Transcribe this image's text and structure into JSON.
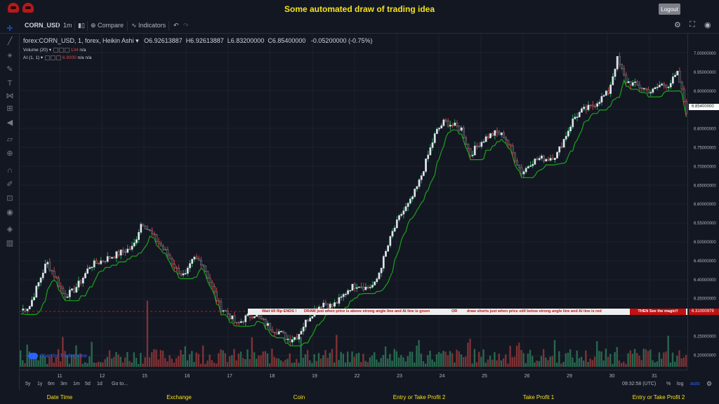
{
  "header": {
    "title": "Some automated draw of trading idea",
    "logout_label": "Logout"
  },
  "toolbar": {
    "symbol": "CORN_USD",
    "interval": "1m",
    "compare_label": "Compare",
    "indicators_label": "Indicators"
  },
  "legend": {
    "symbol_line": "forex:CORN_USD, 1, forex, Heikin Ashi",
    "open": "O6.92613887",
    "high": "H6.92613887",
    "low": "L6.83200000",
    "close": "C6.85400000",
    "change": "-0.05200000 (-0.75%)",
    "volume_label": "Volume (20)",
    "volume_value": "134",
    "volume_extra": "n/a",
    "ai_label": "AI (1, 1)",
    "ai_value": "6.9000",
    "ai_extra1": "n/a",
    "ai_extra2": "n/a"
  },
  "banner": {
    "part1": "Wait till flip ENDS  !",
    "part2": "DRAW just when  price is above strong angle line and AI line is green",
    "part3": "OR",
    "part4": "draw shorts just when price still below strong angle line and AI line is red",
    "magic": "THEN See the magic!!"
  },
  "watermark": "Chart by TradingView",
  "price_axis": {
    "labels": [
      "7.00000000",
      "6.95000000",
      "6.90000000",
      "6.80000000",
      "6.75000000",
      "6.70000000",
      "6.65000000",
      "6.60000000",
      "6.55000000",
      "6.50000000",
      "6.45000000",
      "6.40000000",
      "6.35000000",
      "6.25000000",
      "6.20000000"
    ],
    "last_price": "6.85400000",
    "highlight_price": "6.31000979"
  },
  "date_axis": {
    "labels": [
      "11",
      "12",
      "15",
      "16",
      "17",
      "18",
      "19",
      "22",
      "23",
      "24",
      "25",
      "26",
      "29",
      "30",
      "31",
      "09:"
    ]
  },
  "bottom_bar": {
    "ranges": [
      "5y",
      "1y",
      "6m",
      "3m",
      "1m",
      "5d",
      "1d"
    ],
    "goto_label": "Go to...",
    "time": "09:32:58 (UTC)",
    "percent": "%",
    "log": "log",
    "auto": "auto"
  },
  "footer": {
    "columns": [
      "Date Time",
      "Exchange",
      "Coin",
      "Entry or Take Profit 2",
      "Take Profit 1",
      "Entry or Take Profit 2"
    ]
  },
  "colors": {
    "up": "#e0e3eb",
    "down": "#1f2226",
    "wick_up": "#26a65b",
    "wick_down": "#d23a3a",
    "ai_line": "#19a319",
    "vol_up": "#2e7d5b",
    "vol_down": "#9c3a3a"
  },
  "chart_data": {
    "type": "candlestick",
    "style": "Heikin Ashi",
    "ylim": [
      6.17,
      7.02
    ],
    "days": [
      "11",
      "12",
      "15",
      "16",
      "17",
      "18",
      "19",
      "22",
      "23",
      "24",
      "25",
      "26",
      "29",
      "30",
      "31"
    ],
    "path": [
      6.31,
      6.32,
      6.38,
      6.44,
      6.4,
      6.35,
      6.36,
      6.39,
      6.43,
      6.44,
      6.45,
      6.46,
      6.47,
      6.48,
      6.55,
      6.52,
      6.49,
      6.46,
      6.42,
      6.4,
      6.45,
      6.44,
      6.38,
      6.32,
      6.3,
      6.27,
      6.29,
      6.3,
      6.28,
      6.26,
      6.25,
      6.23,
      6.24,
      6.28,
      6.31,
      6.33,
      6.32,
      6.34,
      6.37,
      6.38,
      6.37,
      6.38,
      6.45,
      6.52,
      6.57,
      6.6,
      6.65,
      6.72,
      6.79,
      6.82,
      6.81,
      6.8,
      6.73,
      6.76,
      6.78,
      6.79,
      6.78,
      6.73,
      6.68,
      6.71,
      6.72,
      6.72,
      6.73,
      6.78,
      6.83,
      6.85,
      6.86,
      6.88,
      6.9,
      6.99,
      6.93,
      6.92,
      6.91,
      6.9,
      6.92,
      6.92,
      6.95,
      6.85
    ],
    "volume_label": "Volume (20)"
  }
}
